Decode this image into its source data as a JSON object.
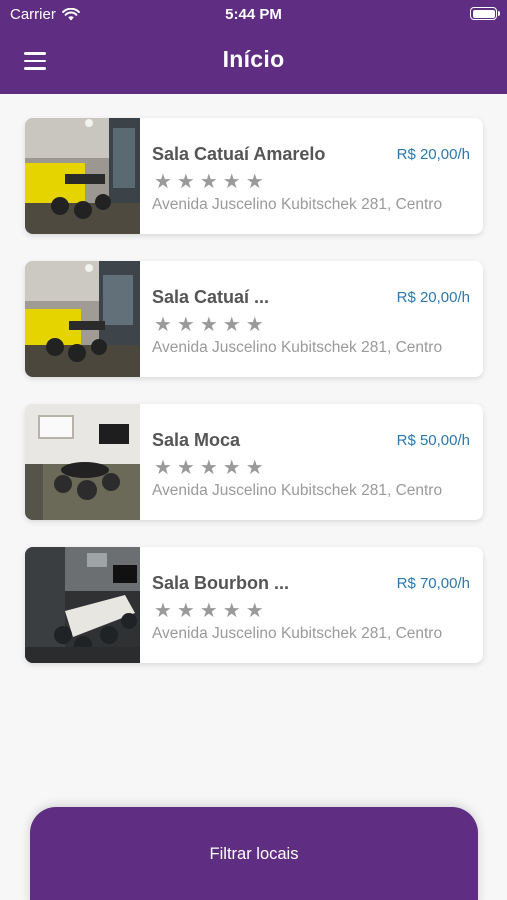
{
  "status_bar": {
    "carrier": "Carrier",
    "time": "5:44 PM"
  },
  "header": {
    "title": "Início"
  },
  "rooms": [
    {
      "name": "Sala Catuaí Amarelo",
      "price": "R$ 20,00/h",
      "rating": 0,
      "stars": "★★★★★",
      "address": "Avenida Juscelino Kubitschek 281, Centro",
      "thumb_icon": "room-photo-yellow-wall"
    },
    {
      "name": "Sala Catuaí ...",
      "price": "R$ 20,00/h",
      "rating": 0,
      "stars": "★★★★★",
      "address": "Avenida Juscelino Kubitschek 281, Centro",
      "thumb_icon": "room-photo-yellow-wall"
    },
    {
      "name": "Sala Moca",
      "price": "R$ 50,00/h",
      "rating": 0,
      "stars": "★★★★★",
      "address": "Avenida Juscelino Kubitschek 281, Centro",
      "thumb_icon": "room-photo-round-table"
    },
    {
      "name": "Sala Bourbon ...",
      "price": "R$ 70,00/h",
      "rating": 0,
      "stars": "★★★★★",
      "address": "Avenida Juscelino Kubitschek 281, Centro",
      "thumb_icon": "room-photo-meeting-table"
    }
  ],
  "filter_button": {
    "label": "Filtrar locais"
  },
  "colors": {
    "brand": "#5f2d82",
    "price": "#2a78b0",
    "muted": "#9a9a9a",
    "accent_yellow": "#e6d400"
  }
}
